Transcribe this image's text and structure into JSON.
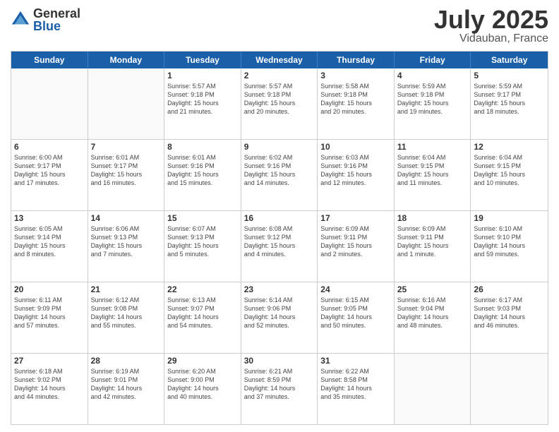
{
  "logo": {
    "general": "General",
    "blue": "Blue"
  },
  "title": {
    "month": "July 2025",
    "location": "Vidauban, France"
  },
  "header_days": [
    "Sunday",
    "Monday",
    "Tuesday",
    "Wednesday",
    "Thursday",
    "Friday",
    "Saturday"
  ],
  "weeks": [
    [
      {
        "day": "",
        "empty": true
      },
      {
        "day": "",
        "empty": true
      },
      {
        "day": "1",
        "lines": [
          "Sunrise: 5:57 AM",
          "Sunset: 9:18 PM",
          "Daylight: 15 hours",
          "and 21 minutes."
        ]
      },
      {
        "day": "2",
        "lines": [
          "Sunrise: 5:57 AM",
          "Sunset: 9:18 PM",
          "Daylight: 15 hours",
          "and 20 minutes."
        ]
      },
      {
        "day": "3",
        "lines": [
          "Sunrise: 5:58 AM",
          "Sunset: 9:18 PM",
          "Daylight: 15 hours",
          "and 20 minutes."
        ]
      },
      {
        "day": "4",
        "lines": [
          "Sunrise: 5:59 AM",
          "Sunset: 9:18 PM",
          "Daylight: 15 hours",
          "and 19 minutes."
        ]
      },
      {
        "day": "5",
        "lines": [
          "Sunrise: 5:59 AM",
          "Sunset: 9:17 PM",
          "Daylight: 15 hours",
          "and 18 minutes."
        ]
      }
    ],
    [
      {
        "day": "6",
        "lines": [
          "Sunrise: 6:00 AM",
          "Sunset: 9:17 PM",
          "Daylight: 15 hours",
          "and 17 minutes."
        ]
      },
      {
        "day": "7",
        "lines": [
          "Sunrise: 6:01 AM",
          "Sunset: 9:17 PM",
          "Daylight: 15 hours",
          "and 16 minutes."
        ]
      },
      {
        "day": "8",
        "lines": [
          "Sunrise: 6:01 AM",
          "Sunset: 9:16 PM",
          "Daylight: 15 hours",
          "and 15 minutes."
        ]
      },
      {
        "day": "9",
        "lines": [
          "Sunrise: 6:02 AM",
          "Sunset: 9:16 PM",
          "Daylight: 15 hours",
          "and 14 minutes."
        ]
      },
      {
        "day": "10",
        "lines": [
          "Sunrise: 6:03 AM",
          "Sunset: 9:16 PM",
          "Daylight: 15 hours",
          "and 12 minutes."
        ]
      },
      {
        "day": "11",
        "lines": [
          "Sunrise: 6:04 AM",
          "Sunset: 9:15 PM",
          "Daylight: 15 hours",
          "and 11 minutes."
        ]
      },
      {
        "day": "12",
        "lines": [
          "Sunrise: 6:04 AM",
          "Sunset: 9:15 PM",
          "Daylight: 15 hours",
          "and 10 minutes."
        ]
      }
    ],
    [
      {
        "day": "13",
        "lines": [
          "Sunrise: 6:05 AM",
          "Sunset: 9:14 PM",
          "Daylight: 15 hours",
          "and 8 minutes."
        ]
      },
      {
        "day": "14",
        "lines": [
          "Sunrise: 6:06 AM",
          "Sunset: 9:13 PM",
          "Daylight: 15 hours",
          "and 7 minutes."
        ]
      },
      {
        "day": "15",
        "lines": [
          "Sunrise: 6:07 AM",
          "Sunset: 9:13 PM",
          "Daylight: 15 hours",
          "and 5 minutes."
        ]
      },
      {
        "day": "16",
        "lines": [
          "Sunrise: 6:08 AM",
          "Sunset: 9:12 PM",
          "Daylight: 15 hours",
          "and 4 minutes."
        ]
      },
      {
        "day": "17",
        "lines": [
          "Sunrise: 6:09 AM",
          "Sunset: 9:11 PM",
          "Daylight: 15 hours",
          "and 2 minutes."
        ]
      },
      {
        "day": "18",
        "lines": [
          "Sunrise: 6:09 AM",
          "Sunset: 9:11 PM",
          "Daylight: 15 hours",
          "and 1 minute."
        ]
      },
      {
        "day": "19",
        "lines": [
          "Sunrise: 6:10 AM",
          "Sunset: 9:10 PM",
          "Daylight: 14 hours",
          "and 59 minutes."
        ]
      }
    ],
    [
      {
        "day": "20",
        "lines": [
          "Sunrise: 6:11 AM",
          "Sunset: 9:09 PM",
          "Daylight: 14 hours",
          "and 57 minutes."
        ]
      },
      {
        "day": "21",
        "lines": [
          "Sunrise: 6:12 AM",
          "Sunset: 9:08 PM",
          "Daylight: 14 hours",
          "and 55 minutes."
        ]
      },
      {
        "day": "22",
        "lines": [
          "Sunrise: 6:13 AM",
          "Sunset: 9:07 PM",
          "Daylight: 14 hours",
          "and 54 minutes."
        ]
      },
      {
        "day": "23",
        "lines": [
          "Sunrise: 6:14 AM",
          "Sunset: 9:06 PM",
          "Daylight: 14 hours",
          "and 52 minutes."
        ]
      },
      {
        "day": "24",
        "lines": [
          "Sunrise: 6:15 AM",
          "Sunset: 9:05 PM",
          "Daylight: 14 hours",
          "and 50 minutes."
        ]
      },
      {
        "day": "25",
        "lines": [
          "Sunrise: 6:16 AM",
          "Sunset: 9:04 PM",
          "Daylight: 14 hours",
          "and 48 minutes."
        ]
      },
      {
        "day": "26",
        "lines": [
          "Sunrise: 6:17 AM",
          "Sunset: 9:03 PM",
          "Daylight: 14 hours",
          "and 46 minutes."
        ]
      }
    ],
    [
      {
        "day": "27",
        "lines": [
          "Sunrise: 6:18 AM",
          "Sunset: 9:02 PM",
          "Daylight: 14 hours",
          "and 44 minutes."
        ]
      },
      {
        "day": "28",
        "lines": [
          "Sunrise: 6:19 AM",
          "Sunset: 9:01 PM",
          "Daylight: 14 hours",
          "and 42 minutes."
        ]
      },
      {
        "day": "29",
        "lines": [
          "Sunrise: 6:20 AM",
          "Sunset: 9:00 PM",
          "Daylight: 14 hours",
          "and 40 minutes."
        ]
      },
      {
        "day": "30",
        "lines": [
          "Sunrise: 6:21 AM",
          "Sunset: 8:59 PM",
          "Daylight: 14 hours",
          "and 37 minutes."
        ]
      },
      {
        "day": "31",
        "lines": [
          "Sunrise: 6:22 AM",
          "Sunset: 8:58 PM",
          "Daylight: 14 hours",
          "and 35 minutes."
        ]
      },
      {
        "day": "",
        "empty": true
      },
      {
        "day": "",
        "empty": true
      }
    ]
  ]
}
